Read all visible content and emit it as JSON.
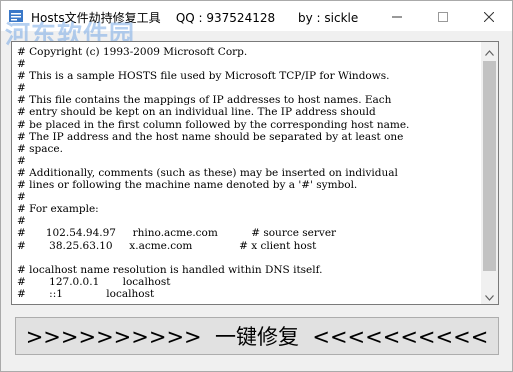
{
  "window": {
    "title": "Hosts文件劫持修复工具    QQ : 937524128      by : sickle",
    "watermark": "河东软件园"
  },
  "hosts_file_lines": [
    "# Copyright (c) 1993-2009 Microsoft Corp.",
    "#",
    "# This is a sample HOSTS file used by Microsoft TCP/IP for Windows.",
    "#",
    "# This file contains the mappings of IP addresses to host names. Each",
    "# entry should be kept on an individual line. The IP address should",
    "# be placed in the first column followed by the corresponding host name.",
    "# The IP address and the host name should be separated by at least one",
    "# space.",
    "#",
    "# Additionally, comments (such as these) may be inserted on individual",
    "# lines or following the machine name denoted by a '#' symbol.",
    "#",
    "# For example:",
    "#",
    "#      102.54.94.97     rhino.acme.com          # source server",
    "#       38.25.63.10     x.acme.com              # x client host",
    "",
    "# localhost name resolution is handled within DNS itself.",
    "#       127.0.0.1       localhost",
    "#       ::1             localhost"
  ],
  "repair_button": {
    "label": ">>>>>>>>>>  一键修复  <<<<<<<<<<"
  },
  "icons": {
    "app": "app-icon",
    "minimize": "minimize-icon",
    "maximize": "maximize-icon",
    "close": "close-icon"
  }
}
